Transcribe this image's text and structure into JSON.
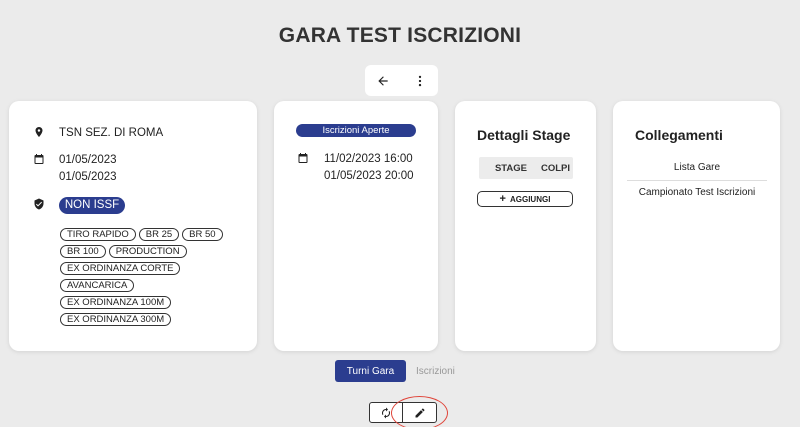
{
  "page": {
    "title": "GARA TEST ISCRIZIONI"
  },
  "toolbar": {
    "back_icon": "arrow-left-icon",
    "menu_icon": "more-vertical-icon"
  },
  "venue": {
    "location": "TSN SEZ. DI ROMA",
    "date_start": "01/05/2023",
    "date_end": "01/05/2023",
    "category": "NON ISSF",
    "disciplines": [
      "TIRO RAPIDO",
      "BR 25",
      "BR 50",
      "BR 100",
      "PRODUCTION",
      "EX ORDINANZA CORTE",
      "AVANCARICA",
      "EX ORDINANZA 100M",
      "EX ORDINANZA 300M"
    ]
  },
  "iscrizioni": {
    "status": "Iscrizioni Aperte",
    "open": "11/02/2023 16:00",
    "close": "01/05/2023 20:00"
  },
  "stage": {
    "title": "Dettagli Stage",
    "columns": [
      "STAGE",
      "COLPI"
    ],
    "add_label": "AGGIUNGI"
  },
  "links": {
    "title": "Collegamenti",
    "items": [
      "Lista Gare",
      "Campionato Test Iscrizioni"
    ]
  },
  "tabs": [
    {
      "label": "Turni Gara",
      "active": true
    },
    {
      "label": "Iscrizioni",
      "active": false
    }
  ],
  "actions": {
    "refresh_icon": "refresh-icon",
    "edit_icon": "pencil-icon"
  },
  "colors": {
    "accent": "#2b3d8f",
    "annotation": "#e0453a"
  }
}
